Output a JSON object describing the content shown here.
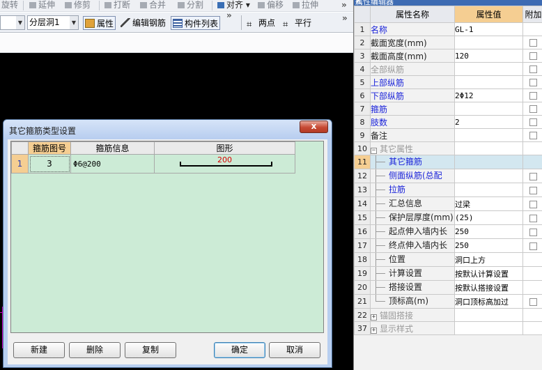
{
  "toolbar_top": {
    "items": [
      "旋转",
      "延伸",
      "修剪",
      "打断",
      "合并",
      "分割",
      "对齐",
      "偏移",
      "拉伸"
    ]
  },
  "toolbar": {
    "combo_left": "",
    "combo_layer": "分层洞1",
    "properties_label": "属性",
    "edit_rebar_label": "编辑钢筋",
    "component_list_label": "构件列表",
    "two_points_label": "两点",
    "parallel_label": "平行",
    "overflow": "»"
  },
  "panel": {
    "title": "属性编辑器",
    "columns": {
      "name": "属性名称",
      "value": "属性值",
      "extra": "附加"
    },
    "rows": [
      {
        "num": "1",
        "name": "名称",
        "value": "GL-1",
        "checkbox": false,
        "style": "blue"
      },
      {
        "num": "2",
        "name": "截面宽度(mm)",
        "value": "",
        "checkbox": true,
        "style": "dark"
      },
      {
        "num": "3",
        "name": "截面高度(mm)",
        "value": "120",
        "checkbox": true,
        "style": "dark"
      },
      {
        "num": "4",
        "name": "全部纵筋",
        "value": "",
        "checkbox": true,
        "style": "gray"
      },
      {
        "num": "5",
        "name": "上部纵筋",
        "value": "",
        "checkbox": true,
        "style": "blue"
      },
      {
        "num": "6",
        "name": "下部纵筋",
        "value": "2Φ12",
        "checkbox": true,
        "style": "blue"
      },
      {
        "num": "7",
        "name": "箍筋",
        "value": "",
        "checkbox": true,
        "style": "blue"
      },
      {
        "num": "8",
        "name": "肢数",
        "value": "2",
        "checkbox": true,
        "style": "blue"
      },
      {
        "num": "9",
        "name": "备注",
        "value": "",
        "checkbox": true,
        "style": "dark"
      },
      {
        "num": "10",
        "name": "其它属性",
        "value": "",
        "checkbox": false,
        "style": "gray",
        "expander": "−"
      },
      {
        "num": "11",
        "name": "其它箍筋",
        "value": "",
        "checkbox": false,
        "style": "blue",
        "indent": true,
        "selected": true
      },
      {
        "num": "12",
        "name": "侧面纵筋(总配",
        "value": "",
        "checkbox": true,
        "style": "blue",
        "indent": true
      },
      {
        "num": "13",
        "name": "拉筋",
        "value": "",
        "checkbox": true,
        "style": "blue",
        "indent": true
      },
      {
        "num": "14",
        "name": "汇总信息",
        "value": "过梁",
        "checkbox": true,
        "style": "dark",
        "indent": true
      },
      {
        "num": "15",
        "name": "保护层厚度(mm)",
        "value": "(25)",
        "checkbox": true,
        "style": "dark",
        "indent": true
      },
      {
        "num": "16",
        "name": "起点伸入墙内长",
        "value": "250",
        "checkbox": true,
        "style": "dark",
        "indent": true
      },
      {
        "num": "17",
        "name": "终点伸入墙内长",
        "value": "250",
        "checkbox": true,
        "style": "dark",
        "indent": true
      },
      {
        "num": "18",
        "name": "位置",
        "value": "洞口上方",
        "checkbox": false,
        "style": "dark",
        "indent": true
      },
      {
        "num": "19",
        "name": "计算设置",
        "value": "按默认计算设置",
        "checkbox": false,
        "style": "dark",
        "indent": true
      },
      {
        "num": "20",
        "name": "搭接设置",
        "value": "按默认搭接设置",
        "checkbox": false,
        "style": "dark",
        "indent": true
      },
      {
        "num": "21",
        "name": "顶标高(m)",
        "value": "洞口顶标高加过",
        "checkbox": true,
        "style": "dark",
        "indent": true,
        "last": true
      },
      {
        "num": "22",
        "name": "锚固搭接",
        "value": "",
        "checkbox": false,
        "style": "gray",
        "expander": "+"
      },
      {
        "num": "37",
        "name": "显示样式",
        "value": "",
        "checkbox": false,
        "style": "gray",
        "expander": "+"
      }
    ]
  },
  "dialog": {
    "title": "其它箍筋类型设置",
    "close": "x",
    "grid": {
      "headers": [
        "箍筋图号",
        "箍筋信息",
        "图形"
      ],
      "rows": [
        {
          "row": "1",
          "figure_no": "3",
          "info": "Φ6@200",
          "shape_label": "200"
        }
      ]
    },
    "buttons": {
      "new": "新建",
      "delete": "删除",
      "copy": "复制",
      "ok": "确定",
      "cancel": "取消"
    }
  },
  "colors": {
    "selection_orange": "#f5ce92",
    "grid_green": "#ccebd6",
    "name_blue": "#1a23d9",
    "dialog_frame": "#b8cff0",
    "close_red": "#c74a34"
  }
}
